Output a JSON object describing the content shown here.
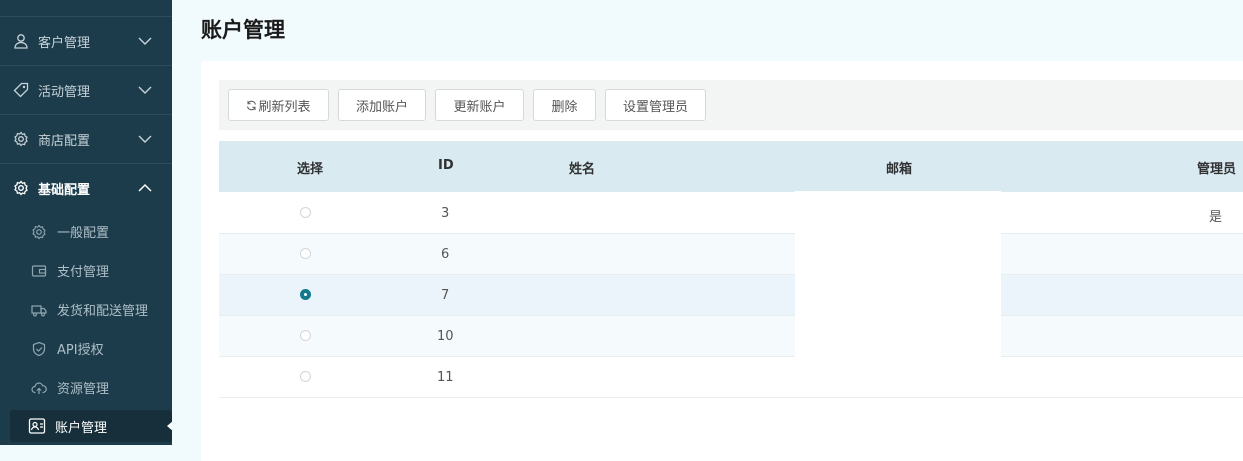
{
  "sidebar": {
    "menu": [
      {
        "label": "客户管理",
        "icon": "user-icon"
      },
      {
        "label": "活动管理",
        "icon": "tag-icon"
      },
      {
        "label": "商店配置",
        "icon": "gear-icon"
      },
      {
        "label": "基础配置",
        "icon": "gear-icon",
        "expanded": true
      }
    ],
    "sub": [
      {
        "label": "一般配置",
        "icon": "gear-icon"
      },
      {
        "label": "支付管理",
        "icon": "wallet-icon"
      },
      {
        "label": "发货和配送管理",
        "icon": "truck-icon"
      },
      {
        "label": "API授权",
        "icon": "shield-icon"
      },
      {
        "label": "资源管理",
        "icon": "cloud-upload-icon"
      },
      {
        "label": "账户管理",
        "icon": "account-card-icon",
        "active": true
      }
    ]
  },
  "page": {
    "title": "账户管理"
  },
  "toolbar": {
    "refresh": "刷新列表",
    "add": "添加账户",
    "update": "更新账户",
    "delete": "删除",
    "set_admin": "设置管理员"
  },
  "table": {
    "headers": {
      "select": "选择",
      "id": "ID",
      "name": "姓名",
      "email": "邮箱",
      "admin": "管理员"
    },
    "rows": [
      {
        "id": "3",
        "name": "",
        "email": "",
        "admin": "是",
        "selected": false
      },
      {
        "id": "6",
        "name": "",
        "email": "",
        "admin": "",
        "selected": false
      },
      {
        "id": "7",
        "name": "",
        "email": "",
        "admin": "",
        "selected": true
      },
      {
        "id": "10",
        "name": "",
        "email": "",
        "admin": "",
        "selected": false
      },
      {
        "id": "11",
        "name": "",
        "email": "",
        "admin": "",
        "selected": false
      }
    ]
  },
  "colors": {
    "sidebar_bg": "#1d3c4b",
    "accent": "#127a8a",
    "header_bg": "#d9ebf1"
  }
}
